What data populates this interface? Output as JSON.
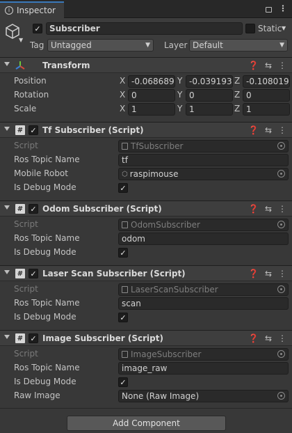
{
  "tab": {
    "title": "Inspector"
  },
  "object": {
    "name": "Subscriber",
    "static_label": "Static",
    "tag_label": "Tag",
    "tag_value": "Untagged",
    "layer_label": "Layer",
    "layer_value": "Default"
  },
  "transform": {
    "title": "Transform",
    "rows": [
      {
        "label": "Position",
        "x": "-0.068689",
        "y": "-0.039193",
        "z": "-0.1080190"
      },
      {
        "label": "Rotation",
        "x": "0",
        "y": "0",
        "z": "0"
      },
      {
        "label": "Scale",
        "x": "1",
        "y": "1",
        "z": "1"
      }
    ],
    "axes": [
      "X",
      "Y",
      "Z"
    ]
  },
  "components": [
    {
      "title": "Tf Subscriber (Script)",
      "script_label": "Script",
      "script_value": "TfSubscriber",
      "topic_label": "Ros Topic Name",
      "topic_value": "tf",
      "extra_label": "Mobile Robot",
      "extra_value": "raspimouse",
      "debug_label": "Is Debug Mode"
    },
    {
      "title": "Odom Subscriber (Script)",
      "script_label": "Script",
      "script_value": "OdomSubscriber",
      "topic_label": "Ros Topic Name",
      "topic_value": "odom",
      "debug_label": "Is Debug Mode"
    },
    {
      "title": "Laser Scan Subscriber (Script)",
      "script_label": "Script",
      "script_value": "LaserScanSubscriber",
      "topic_label": "Ros Topic Name",
      "topic_value": "scan",
      "debug_label": "Is Debug Mode"
    },
    {
      "title": "Image Subscriber (Script)",
      "script_label": "Script",
      "script_value": "ImageSubscriber",
      "topic_label": "Ros Topic Name",
      "topic_value": "image_raw",
      "debug_label": "Is Debug Mode",
      "raw_label": "Raw Image",
      "raw_value": "None (Raw Image)"
    }
  ],
  "add_component_label": "Add Component",
  "icons": {
    "inspector_tab": "info-icon",
    "lock": "lock-icon",
    "menu": "kebab-menu-icon",
    "gameobject": "cube-icon",
    "transform": "transform-axes-icon",
    "script": "csharp-script-icon",
    "help": "help-icon",
    "presets": "presets-sliders-icon",
    "object_picker": "object-picker-icon"
  },
  "colors": {
    "background": "#383838",
    "header": "#3e3e3e",
    "tab_accent": "#3a79bb"
  }
}
